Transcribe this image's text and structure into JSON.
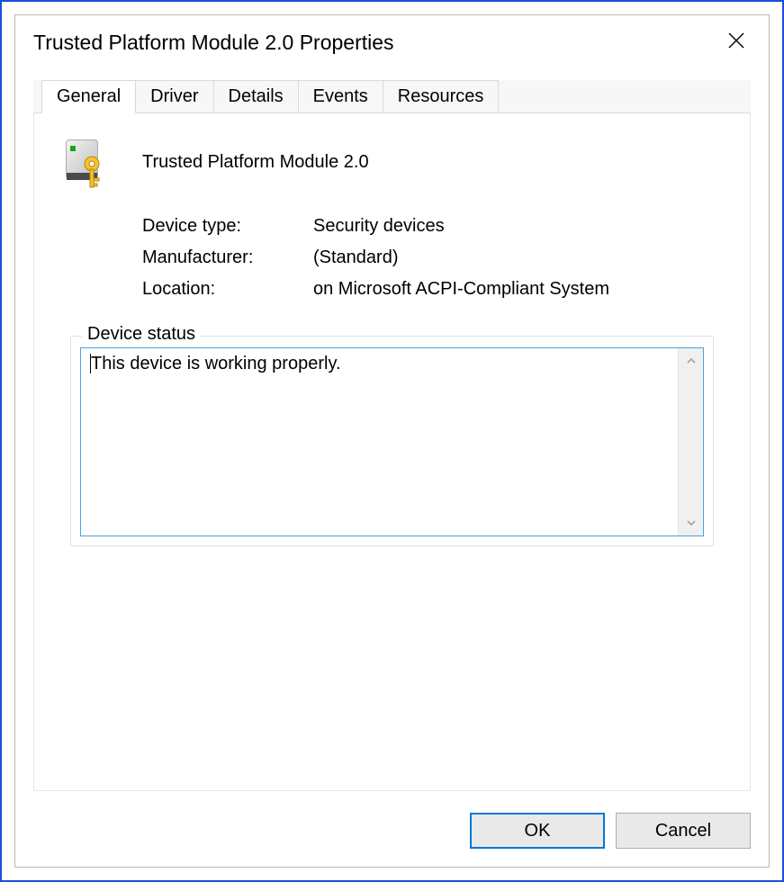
{
  "window": {
    "title": "Trusted Platform Module 2.0 Properties"
  },
  "tabs": [
    {
      "label": "General",
      "active": true
    },
    {
      "label": "Driver",
      "active": false
    },
    {
      "label": "Details",
      "active": false
    },
    {
      "label": "Events",
      "active": false
    },
    {
      "label": "Resources",
      "active": false
    }
  ],
  "device": {
    "name": "Trusted Platform Module 2.0",
    "type_label": "Device type:",
    "type_value": "Security devices",
    "manufacturer_label": "Manufacturer:",
    "manufacturer_value": "(Standard)",
    "location_label": "Location:",
    "location_value": "on Microsoft ACPI-Compliant System"
  },
  "status": {
    "legend": "Device status",
    "text": "This device is working properly."
  },
  "buttons": {
    "ok": "OK",
    "cancel": "Cancel"
  }
}
